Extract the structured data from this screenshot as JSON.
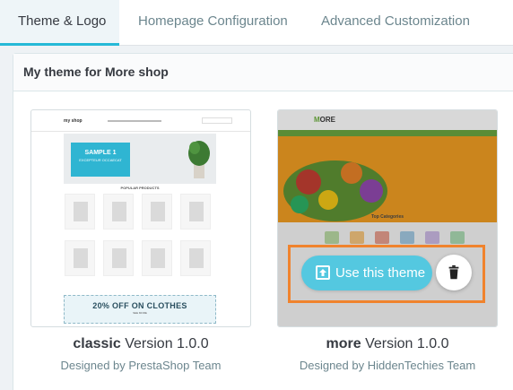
{
  "tabs": [
    {
      "label": "Theme & Logo",
      "active": true
    },
    {
      "label": "Homepage Configuration",
      "active": false
    },
    {
      "label": "Advanced Customization",
      "active": false
    }
  ],
  "panel": {
    "title": "My theme for More shop"
  },
  "themes": [
    {
      "name": "classic",
      "version": "Version 1.0.0",
      "author": "Designed by PrestaShop Team",
      "preview": {
        "logo": "my shop",
        "hero_title": "SAMPLE 1",
        "hero_subtitle": "EXCEPTEUR OCCAECAT",
        "section_heading": "POPULAR PRODUCTS",
        "banner_title": "20% OFF ON CLOTHES",
        "banner_subtitle": "SEE MORE"
      }
    },
    {
      "name": "more",
      "version": "Version 1.0.0",
      "author": "Designed by HiddenTechies Team",
      "preview": {
        "logo_prefix": "M",
        "logo_rest": "ORE",
        "category_heading": "Top Categories"
      }
    }
  ],
  "actions": {
    "use_theme": "Use this theme"
  },
  "colors": {
    "accent": "#25b9d7",
    "button": "#54c8e0",
    "highlight": "#f0832d",
    "more_green": "#65a33a",
    "more_orange": "#f09a1c"
  },
  "icons": {
    "upload": "upload-icon",
    "delete": "trash-icon"
  }
}
